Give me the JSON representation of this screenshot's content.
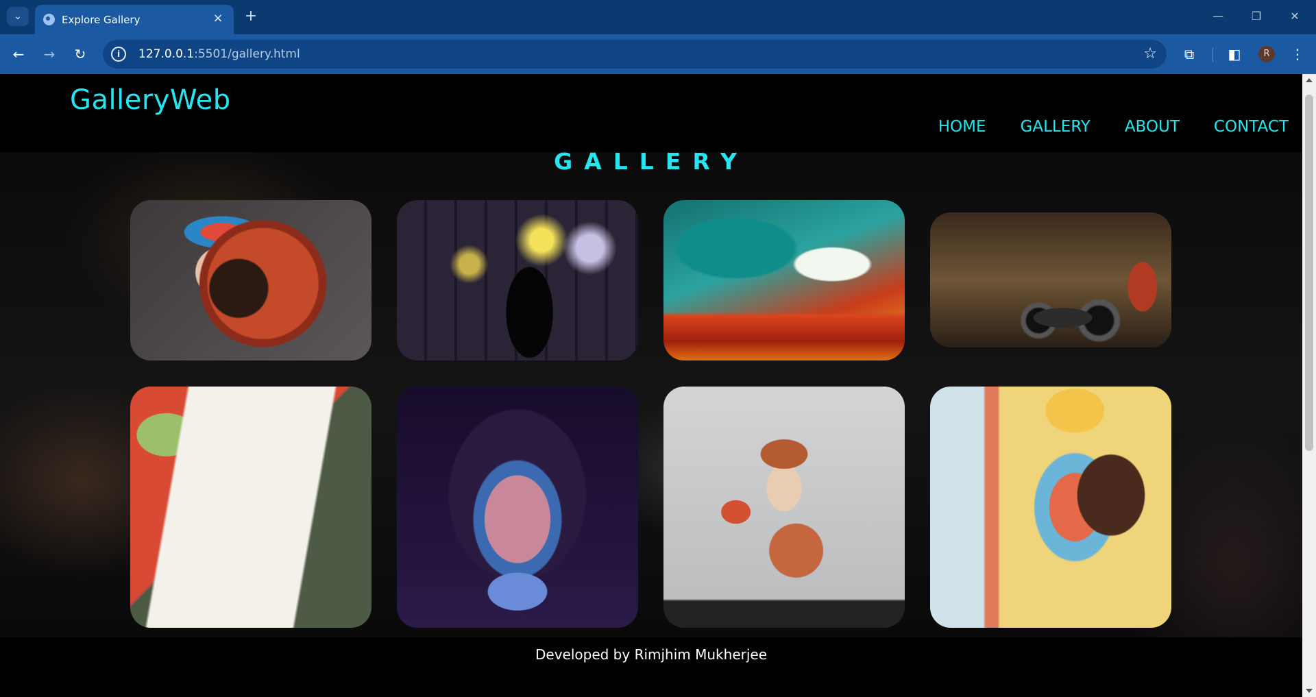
{
  "browser": {
    "tab_title": "Explore Gallery",
    "url_host": "127.0.0.1",
    "url_rest": ":5501/gallery.html",
    "profile_initial": "R"
  },
  "site": {
    "brand": "GalleryWeb",
    "nav": [
      "HOME",
      "GALLERY",
      "ABOUT",
      "CONTACT"
    ],
    "heading": "GALLERY",
    "footer": "Developed by Rimjhim Mukherjee"
  },
  "colors": {
    "accent": "#25e6f0",
    "page_bg": "#000000",
    "chrome_dark": "#0b3a70",
    "chrome": "#1b5aa3"
  },
  "gallery": [
    {
      "name": "portrait-woman-headscarf"
    },
    {
      "name": "graffiti-wall-silhouette"
    },
    {
      "name": "abstract-teal-red-paint"
    },
    {
      "name": "motorcycle-art-shop"
    },
    {
      "name": "watercolor-giraffe"
    },
    {
      "name": "face-paint-butterfly"
    },
    {
      "name": "street-mural-hats"
    },
    {
      "name": "colorful-birds-mural"
    }
  ]
}
